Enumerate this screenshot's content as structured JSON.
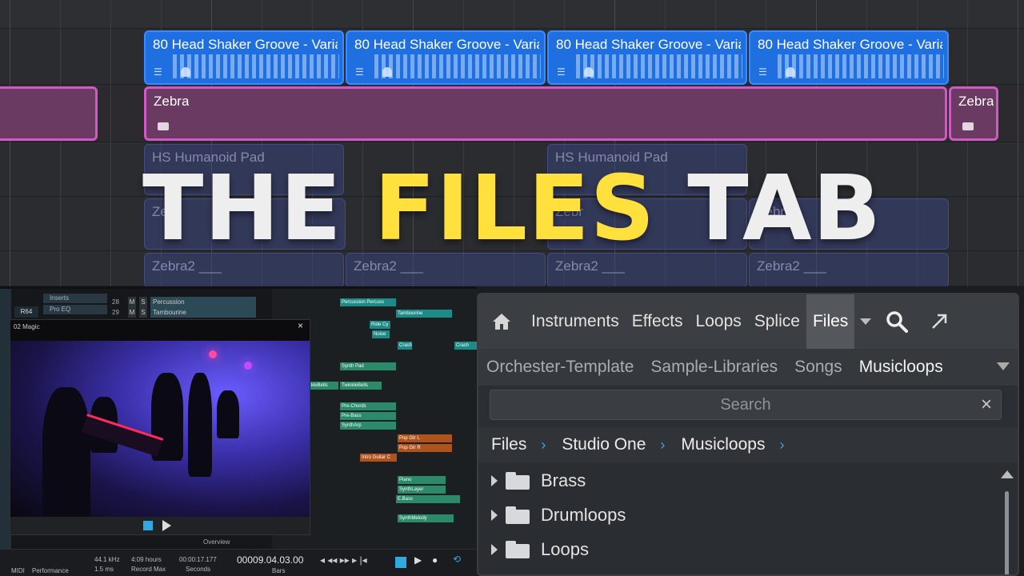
{
  "arrangement": {
    "groove_clips": [
      "80 Head Shaker Groove - Varia",
      "80 Head Shaker Groove - Varia",
      "80 Head Shaker Groove - Varia",
      "80 Head Shaker Groove - Varia"
    ],
    "zebra_clip": "Zebra",
    "zebra_clip_end": "Zebra",
    "pad_clips": [
      "HS Humanoid Pad",
      "HS Humanoid Pad"
    ],
    "zebra2_clips": [
      "Zebra2 ___",
      "Zebra2 ___",
      "Zebra2 ___",
      "Zebra2 ___"
    ],
    "zebra2_mid_clips": [
      "Zebr",
      "Zebr",
      "Zebr"
    ]
  },
  "headline": {
    "word1": "THE",
    "word2": "FILES",
    "word3": "TAB"
  },
  "studio": {
    "inserts": [
      "Inserts",
      "Pro EQ"
    ],
    "r_label": "R64",
    "tracks": [
      {
        "num": "28",
        "m": "M",
        "s": "S",
        "name": "Percussion"
      },
      {
        "num": "29",
        "m": "M",
        "s": "S",
        "name": "Tambourine"
      }
    ],
    "mini_clips": [
      "Percussion Percuss",
      "Tambourine",
      "Ride Cy",
      "Noise",
      "Crash",
      "Crash",
      "Synth Pad",
      "kleBells",
      "TwinkleBells",
      "Pre-Chords",
      "Pre-Bass",
      "SynthArp",
      "Pop Gtr L",
      "Pop Gtr R",
      "Intro Guitar C",
      "Piano",
      "SynthLayer",
      "E.Bass",
      "SynthMelody"
    ],
    "video_title": "02 Magic",
    "overview_label": "Overview",
    "transport": {
      "sample_rate": "44.1 kHz",
      "latency": "1.5 ms",
      "record_time": "4:09 hours",
      "record_label": "Record Max",
      "seconds_value": "00:00:17.177",
      "seconds_label": "Seconds",
      "bars_value": "00009.04.03.00",
      "bars_label": "Bars",
      "midi": "MIDI",
      "performance": "Performance"
    }
  },
  "browser": {
    "tabs": [
      "Instruments",
      "Effects",
      "Loops",
      "Splice",
      "Files"
    ],
    "active_tab": "Files",
    "subtabs": [
      "Orchester-Template",
      "Sample-Libraries",
      "Songs",
      "Musicloops"
    ],
    "active_subtab": "Musicloops",
    "search_placeholder": "Search",
    "clear_icon": "×",
    "breadcrumb": [
      "Files",
      "Studio One",
      "Musicloops"
    ],
    "breadcrumb_sep": "›",
    "folders": [
      "Brass",
      "Drumloops",
      "Loops"
    ]
  },
  "colors": {
    "accent_blue": "#3aa3e8",
    "headline_yellow": "#ffe03c",
    "clip_blue": "#1f6fe0",
    "clip_pink": "#d05ac4"
  }
}
